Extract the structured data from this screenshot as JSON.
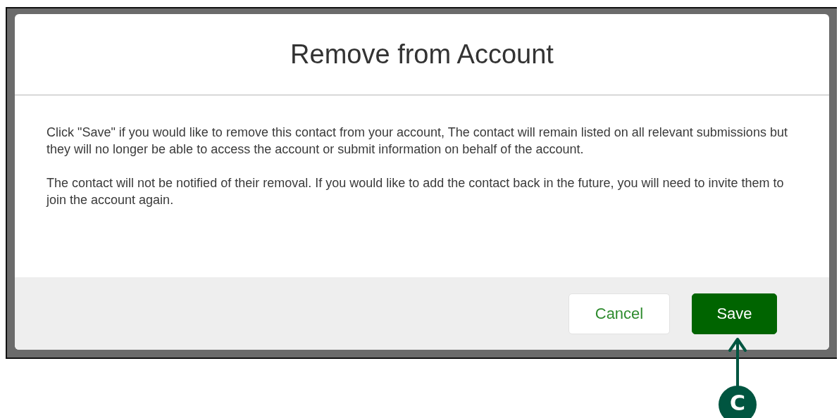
{
  "dialog": {
    "title": "Remove from Account",
    "paragraphs": [
      "Click \"Save\" if you would like to remove this contact from your account, The contact will remain listed on all relevant submissions but they will no longer be able to access the account or submit information on behalf of the account.",
      "The contact will not be notified of their removal. If you would like to add the contact back in the future, you will need to invite them to join the account again."
    ],
    "buttons": [
      {
        "label": "Cancel",
        "kind": "secondary"
      },
      {
        "label": "Save",
        "kind": "primary"
      }
    ]
  },
  "callout": {
    "label": "C"
  }
}
